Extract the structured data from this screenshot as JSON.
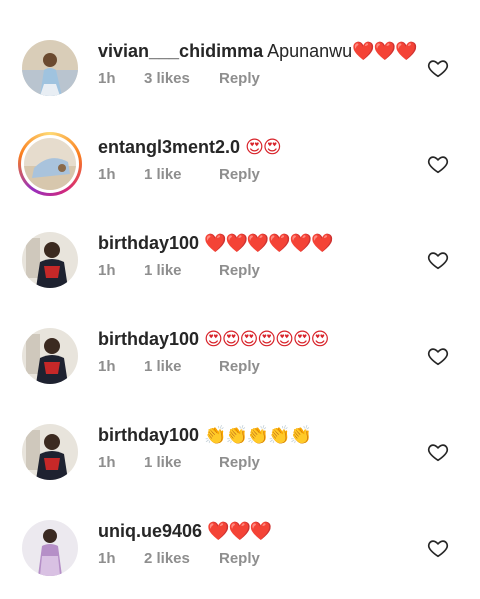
{
  "comments": [
    {
      "username": "vivian___chidimma",
      "text": " Apunanwu",
      "emojis": "❤️❤️❤️",
      "time": "1h",
      "likes": "3 likes",
      "reply": "Reply"
    },
    {
      "username": "entangl3ment2.0",
      "text": " ",
      "emojis": "😍😍",
      "time": "1h",
      "likes": "1 like",
      "reply": "Reply"
    },
    {
      "username": "birthday100",
      "text": " ",
      "emojis": "❤️❤️❤️❤️❤️❤️",
      "time": "1h",
      "likes": "1 like",
      "reply": "Reply"
    },
    {
      "username": "birthday100",
      "text": " ",
      "emojis": "😍😍😍😍😍😍😍",
      "time": "1h",
      "likes": "1 like",
      "reply": "Reply"
    },
    {
      "username": "birthday100",
      "text": " ",
      "emojis": "👏👏👏👏👏",
      "time": "1h",
      "likes": "1 like",
      "reply": "Reply"
    },
    {
      "username": "uniq.ue9406",
      "text": " ",
      "emojis": "❤️❤️❤️",
      "time": "1h",
      "likes": "2 likes",
      "reply": "Reply"
    }
  ],
  "icons": {
    "like": "heart-outline-icon"
  },
  "colors": {
    "primary_text": "#262626",
    "secondary_text": "#8e8e8e",
    "heart_emoji": "#d8232a"
  }
}
